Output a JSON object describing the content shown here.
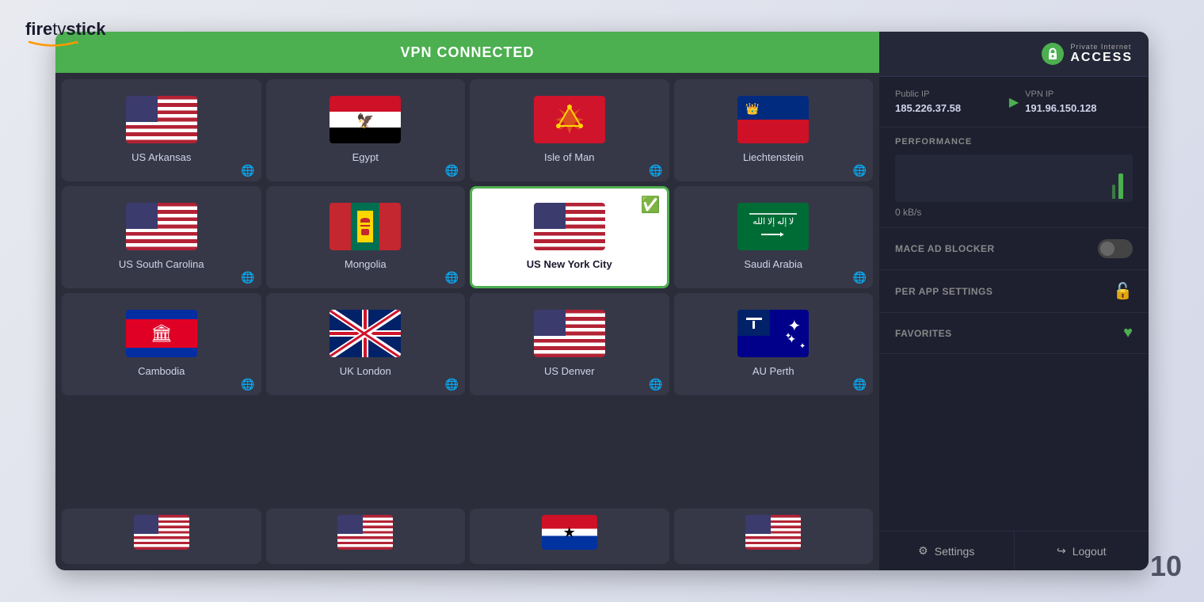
{
  "firetv": {
    "logo_text": "firetvstick"
  },
  "vpn_status": {
    "label": "VPN CONNECTED",
    "color": "#4caf50"
  },
  "ten_badge": "10",
  "right_panel": {
    "pia_label_small": "Private Internet",
    "pia_label_big": "ACCESS",
    "public_ip_label": "Public IP",
    "public_ip_value": "185.226.37.58",
    "vpn_ip_label": "VPN IP",
    "vpn_ip_value": "191.96.150.128",
    "performance_label": "PERFORMANCE",
    "speed_value": "0 kB/s",
    "mace_label": "MACE AD BLOCKER",
    "per_app_label": "PER APP SETTINGS",
    "favorites_label": "FAVORITES",
    "settings_button": "Settings",
    "logout_button": "Logout"
  },
  "locations": [
    {
      "id": "us-arkansas",
      "name": "US Arkansas",
      "flag": "us",
      "active": false
    },
    {
      "id": "egypt",
      "name": "Egypt",
      "flag": "egypt",
      "active": false
    },
    {
      "id": "isle-of-man",
      "name": "Isle of Man",
      "flag": "iom",
      "active": false
    },
    {
      "id": "liechtenstein",
      "name": "Liechtenstein",
      "flag": "liechtenstein",
      "active": false
    },
    {
      "id": "us-south-carolina",
      "name": "US South Carolina",
      "flag": "us",
      "active": false
    },
    {
      "id": "mongolia",
      "name": "Mongolia",
      "flag": "mongolia",
      "active": false
    },
    {
      "id": "us-new-york",
      "name": "US New York City",
      "flag": "us",
      "active": true
    },
    {
      "id": "saudi-arabia",
      "name": "Saudi Arabia",
      "flag": "saudi",
      "active": false
    },
    {
      "id": "cambodia",
      "name": "Cambodia",
      "flag": "cambodia",
      "active": false
    },
    {
      "id": "uk-london",
      "name": "UK London",
      "flag": "uk",
      "active": false
    },
    {
      "id": "us-denver",
      "name": "US Denver",
      "flag": "us",
      "active": false
    },
    {
      "id": "au-perth",
      "name": "AU Perth",
      "flag": "au",
      "active": false
    }
  ]
}
